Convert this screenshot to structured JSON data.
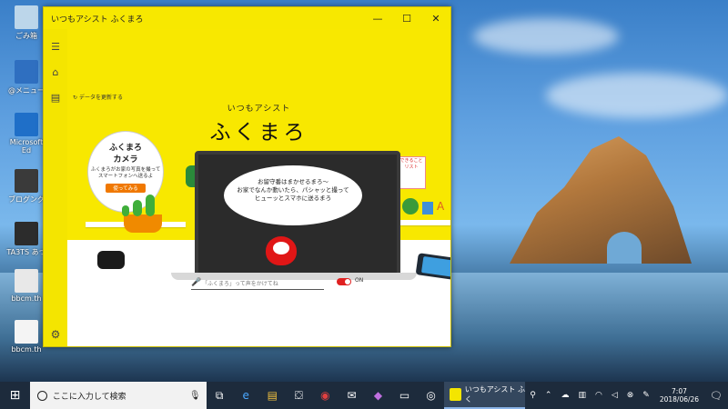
{
  "desktop": {
    "icons": [
      {
        "label": "ごみ箱",
        "color": "#bcd6ea"
      },
      {
        "label": "@メニュー",
        "color": "#2f6fc0"
      },
      {
        "label": "Microsoft Ed",
        "color": "#1f6fc8"
      },
      {
        "label": "ブログング",
        "color": "#3a3a3a"
      },
      {
        "label": "TA3TS あつ",
        "color": "#2c2c2c"
      },
      {
        "label": "bbcm.th",
        "color": "#e8e8e8"
      },
      {
        "label": "bbcm.th",
        "color": "#f4f4f4"
      }
    ]
  },
  "window": {
    "title": "いつもアシスト ふくまろ",
    "controls": {
      "minimize": "—",
      "maximize": "☐",
      "close": "✕"
    },
    "sidebar": {
      "menu_icon": "☰",
      "home_icon": "⌂",
      "chat_icon": "▤",
      "settings_icon": "⚙"
    },
    "refresh_text": "データを更新する",
    "app_subtitle": "いつもアシスト",
    "app_title": "ふくまろ",
    "camera_card": {
      "title1": "ふくまろ",
      "title2": "カメラ",
      "desc": "ふくまろがお家の写真を撮ってスマートフォンへ送るよ",
      "button": "使ってみる"
    },
    "book_label": "できること リスト",
    "laptop_bubble": [
      "お留守番はまかせるまろ〜",
      "お家でなんか動いたら、パシャッと撮って",
      "ヒューッとスマホに送るまろ"
    ],
    "voice_placeholder": "「ふくまろ」って声をかけてね",
    "toggle_label": "ON",
    "accent": "#f4e500"
  },
  "taskbar": {
    "search_placeholder": "ここに入力して検索",
    "active_app": "いつもアシスト ふく",
    "time": "7:07",
    "date": "2018/06/26"
  }
}
